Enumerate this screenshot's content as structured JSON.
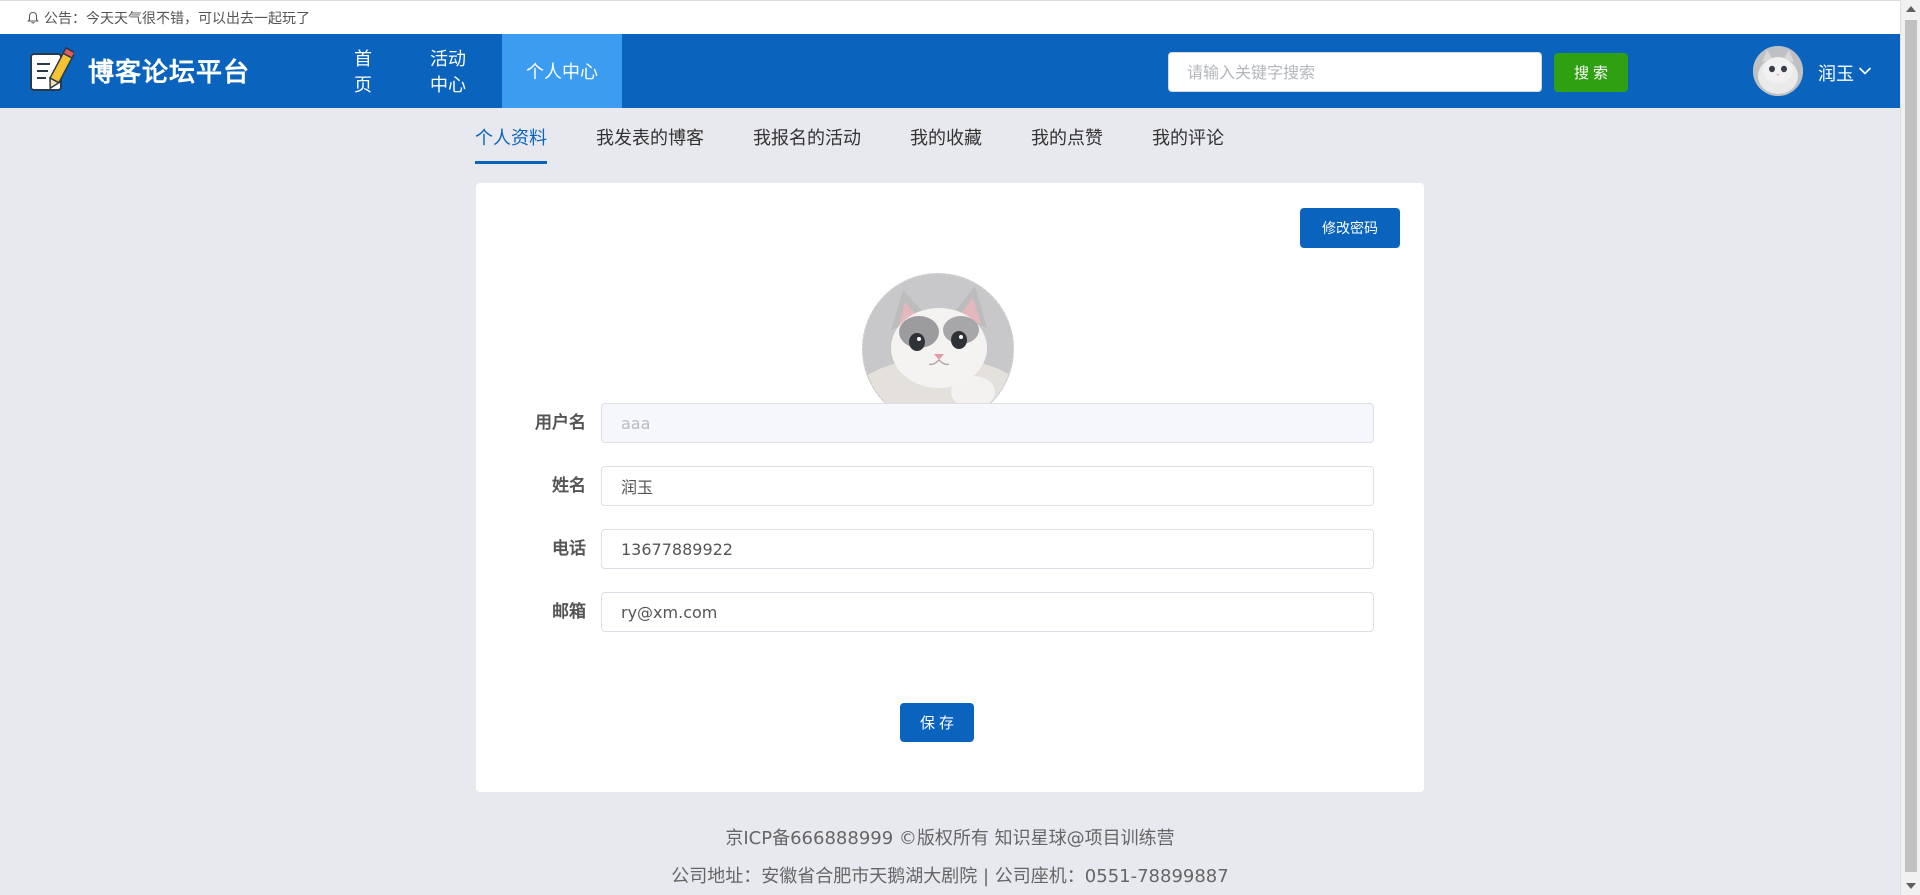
{
  "notice": {
    "text": "公告：今天天气很不错，可以出去一起玩了"
  },
  "header": {
    "site_title": "博客论坛平台",
    "nav": [
      {
        "label": "首页",
        "active": false
      },
      {
        "label": "活动中心",
        "active": false
      },
      {
        "label": "个人中心",
        "active": true
      }
    ],
    "search": {
      "placeholder": "请输入关键字搜索",
      "value": "",
      "button_label": "搜索"
    },
    "user": {
      "name": "润玉"
    }
  },
  "tabs": [
    {
      "label": "个人资料",
      "active": true
    },
    {
      "label": "我发表的博客",
      "active": false
    },
    {
      "label": "我报名的活动",
      "active": false
    },
    {
      "label": "我的收藏",
      "active": false
    },
    {
      "label": "我的点赞",
      "active": false
    },
    {
      "label": "我的评论",
      "active": false
    }
  ],
  "profile": {
    "change_password_label": "修改密码",
    "fields": {
      "username": {
        "label": "用户名",
        "value": "aaa",
        "disabled": true
      },
      "name": {
        "label": "姓名",
        "value": "润玉"
      },
      "phone": {
        "label": "电话",
        "value": "13677889922"
      },
      "email": {
        "label": "邮箱",
        "value": "ry@xm.com"
      }
    },
    "save_label": "保存"
  },
  "footer": {
    "line1": "京ICP备666888999 ©版权所有 知识星球@项目训练营",
    "line2": "公司地址：安徽省合肥市天鹅湖大剧院 | 公司座机：0551-78899887"
  },
  "colors": {
    "primary": "#0a64be",
    "nav_active": "#3c9cf0",
    "search_button": "#2fa012",
    "page_background": "#e8e9ee"
  },
  "icons": [
    "bell-icon",
    "blog-logo-icon",
    "chevron-down-icon",
    "user-avatar-image",
    "profile-avatar-image"
  ]
}
